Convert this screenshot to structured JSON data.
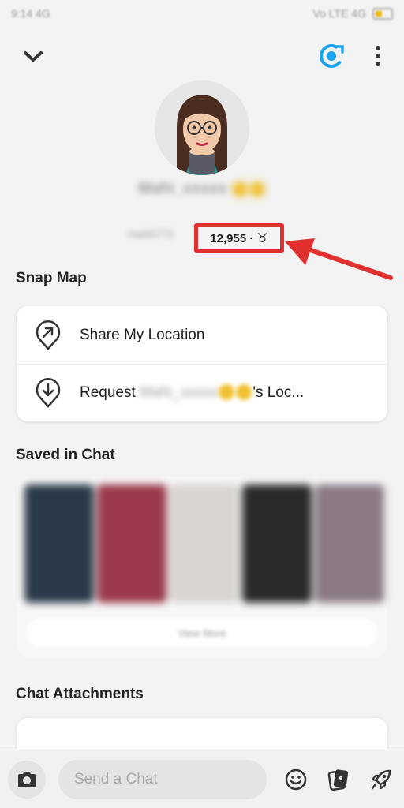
{
  "status_bar": {
    "left": "9:14 4G",
    "right": "Vo LTE 4G"
  },
  "top_bar": {
    "back_icon": "chevron-down-icon",
    "story_icon": "story-ring-icon",
    "menu_icon": "more-vertical-icon"
  },
  "profile": {
    "display_name": "Mahi_xxxxx",
    "username": "mahi0773",
    "snap_score": "12,955 ·",
    "zodiac_symbol": "♉",
    "highlight_color": "#e03030"
  },
  "snap_map": {
    "title": "Snap Map",
    "share_label": "Share My Location",
    "request_prefix": "Request",
    "request_name": "Mahi_xxxxx",
    "request_suffix": "'s Loc..."
  },
  "saved_in_chat": {
    "title": "Saved in Chat",
    "view_more": "View More"
  },
  "chat_attachments": {
    "title": "Chat Attachments"
  },
  "bottom_bar": {
    "input_placeholder": "Send a Chat",
    "icons": [
      "camera-icon",
      "emoji-icon",
      "sticker-icon",
      "rocket-icon"
    ]
  }
}
